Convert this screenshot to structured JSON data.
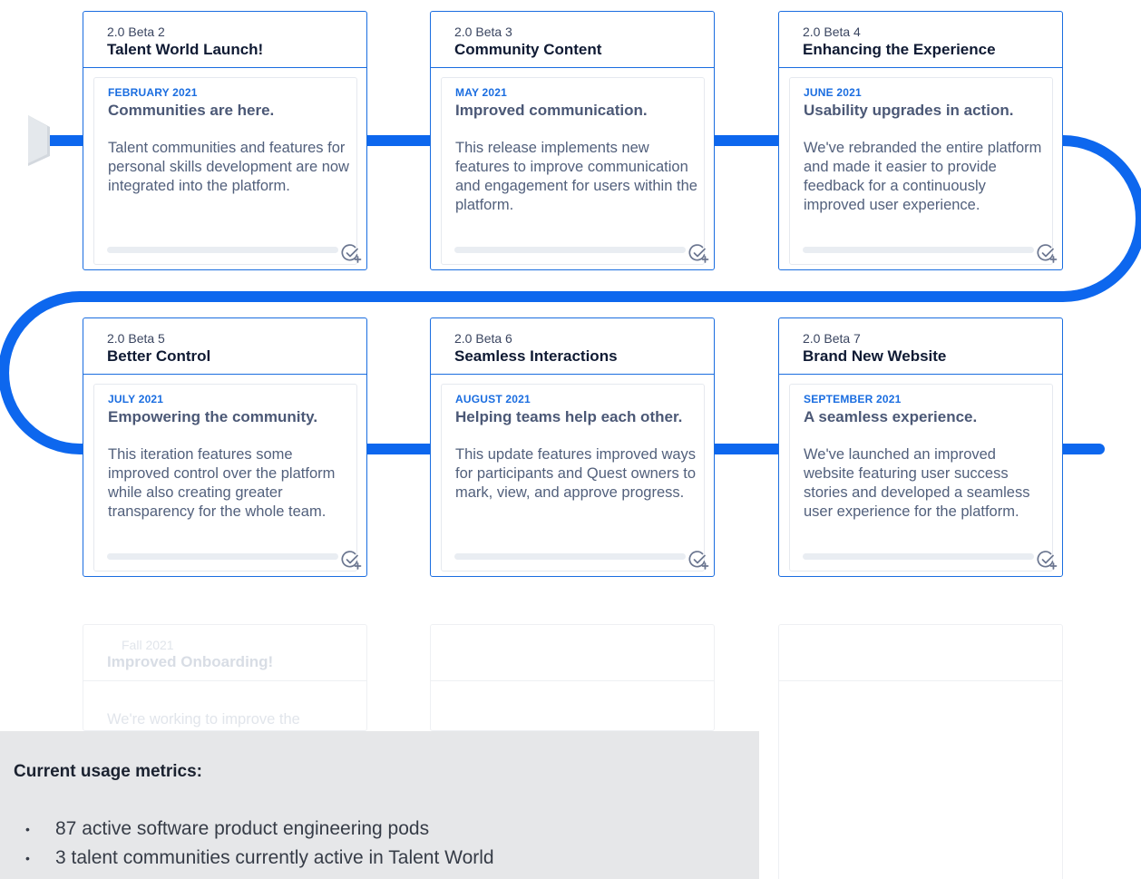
{
  "colors": {
    "accent": "#1a6de0",
    "track": "#0d67ee",
    "metrics_bg": "#e6e7e9"
  },
  "cards": [
    {
      "version": "2.0 Beta 2",
      "name": "Talent World Launch!",
      "date": "FEBRUARY 2021",
      "headline": "Communities are here.",
      "description": "Talent communities and features for personal skills development are now integrated into the platform.",
      "icon": "check-plus-icon"
    },
    {
      "version": "2.0 Beta 3",
      "name": "Community Content",
      "date": "MAY 2021",
      "headline": "Improved communication.",
      "description": "This release implements new features to improve communication and engagement for users within the platform.",
      "icon": "check-plus-icon"
    },
    {
      "version": "2.0 Beta 4",
      "name": "Enhancing the Experience",
      "date": "JUNE 2021",
      "headline": "Usability upgrades in action.",
      "description": "We've rebranded the entire platform and made it easier to provide feedback for a continuously improved user experience.",
      "icon": "check-plus-icon"
    },
    {
      "version": "2.0 Beta 5",
      "name": "Better Control",
      "date": "JULY 2021",
      "headline": "Empowering the community.",
      "description": "This iteration features some improved control over the platform while also creating greater transparency for the whole team.",
      "icon": "check-plus-icon"
    },
    {
      "version": "2.0 Beta 6",
      "name": "Seamless Interactions",
      "date": "AUGUST 2021",
      "headline": "Helping teams help each other.",
      "description": "This update features improved ways for participants and Quest owners to mark, view, and approve progress.",
      "icon": "check-plus-icon"
    },
    {
      "version": "2.0 Beta 7",
      "name": "Brand New Website",
      "date": "SEPTEMBER 2021",
      "headline": "A seamless experience.",
      "description": "We've launched an improved website featuring user success stories and developed a seamless user experience for the platform.",
      "icon": "check-plus-icon"
    }
  ],
  "upcoming": {
    "version": "Fall 2021",
    "name": "Improved Onboarding!",
    "description": "We're working to improve the"
  },
  "metrics": {
    "title": "Current usage metrics:",
    "items": [
      "87 active software product engineering pods",
      "3 talent communities currently active in Talent World"
    ]
  }
}
